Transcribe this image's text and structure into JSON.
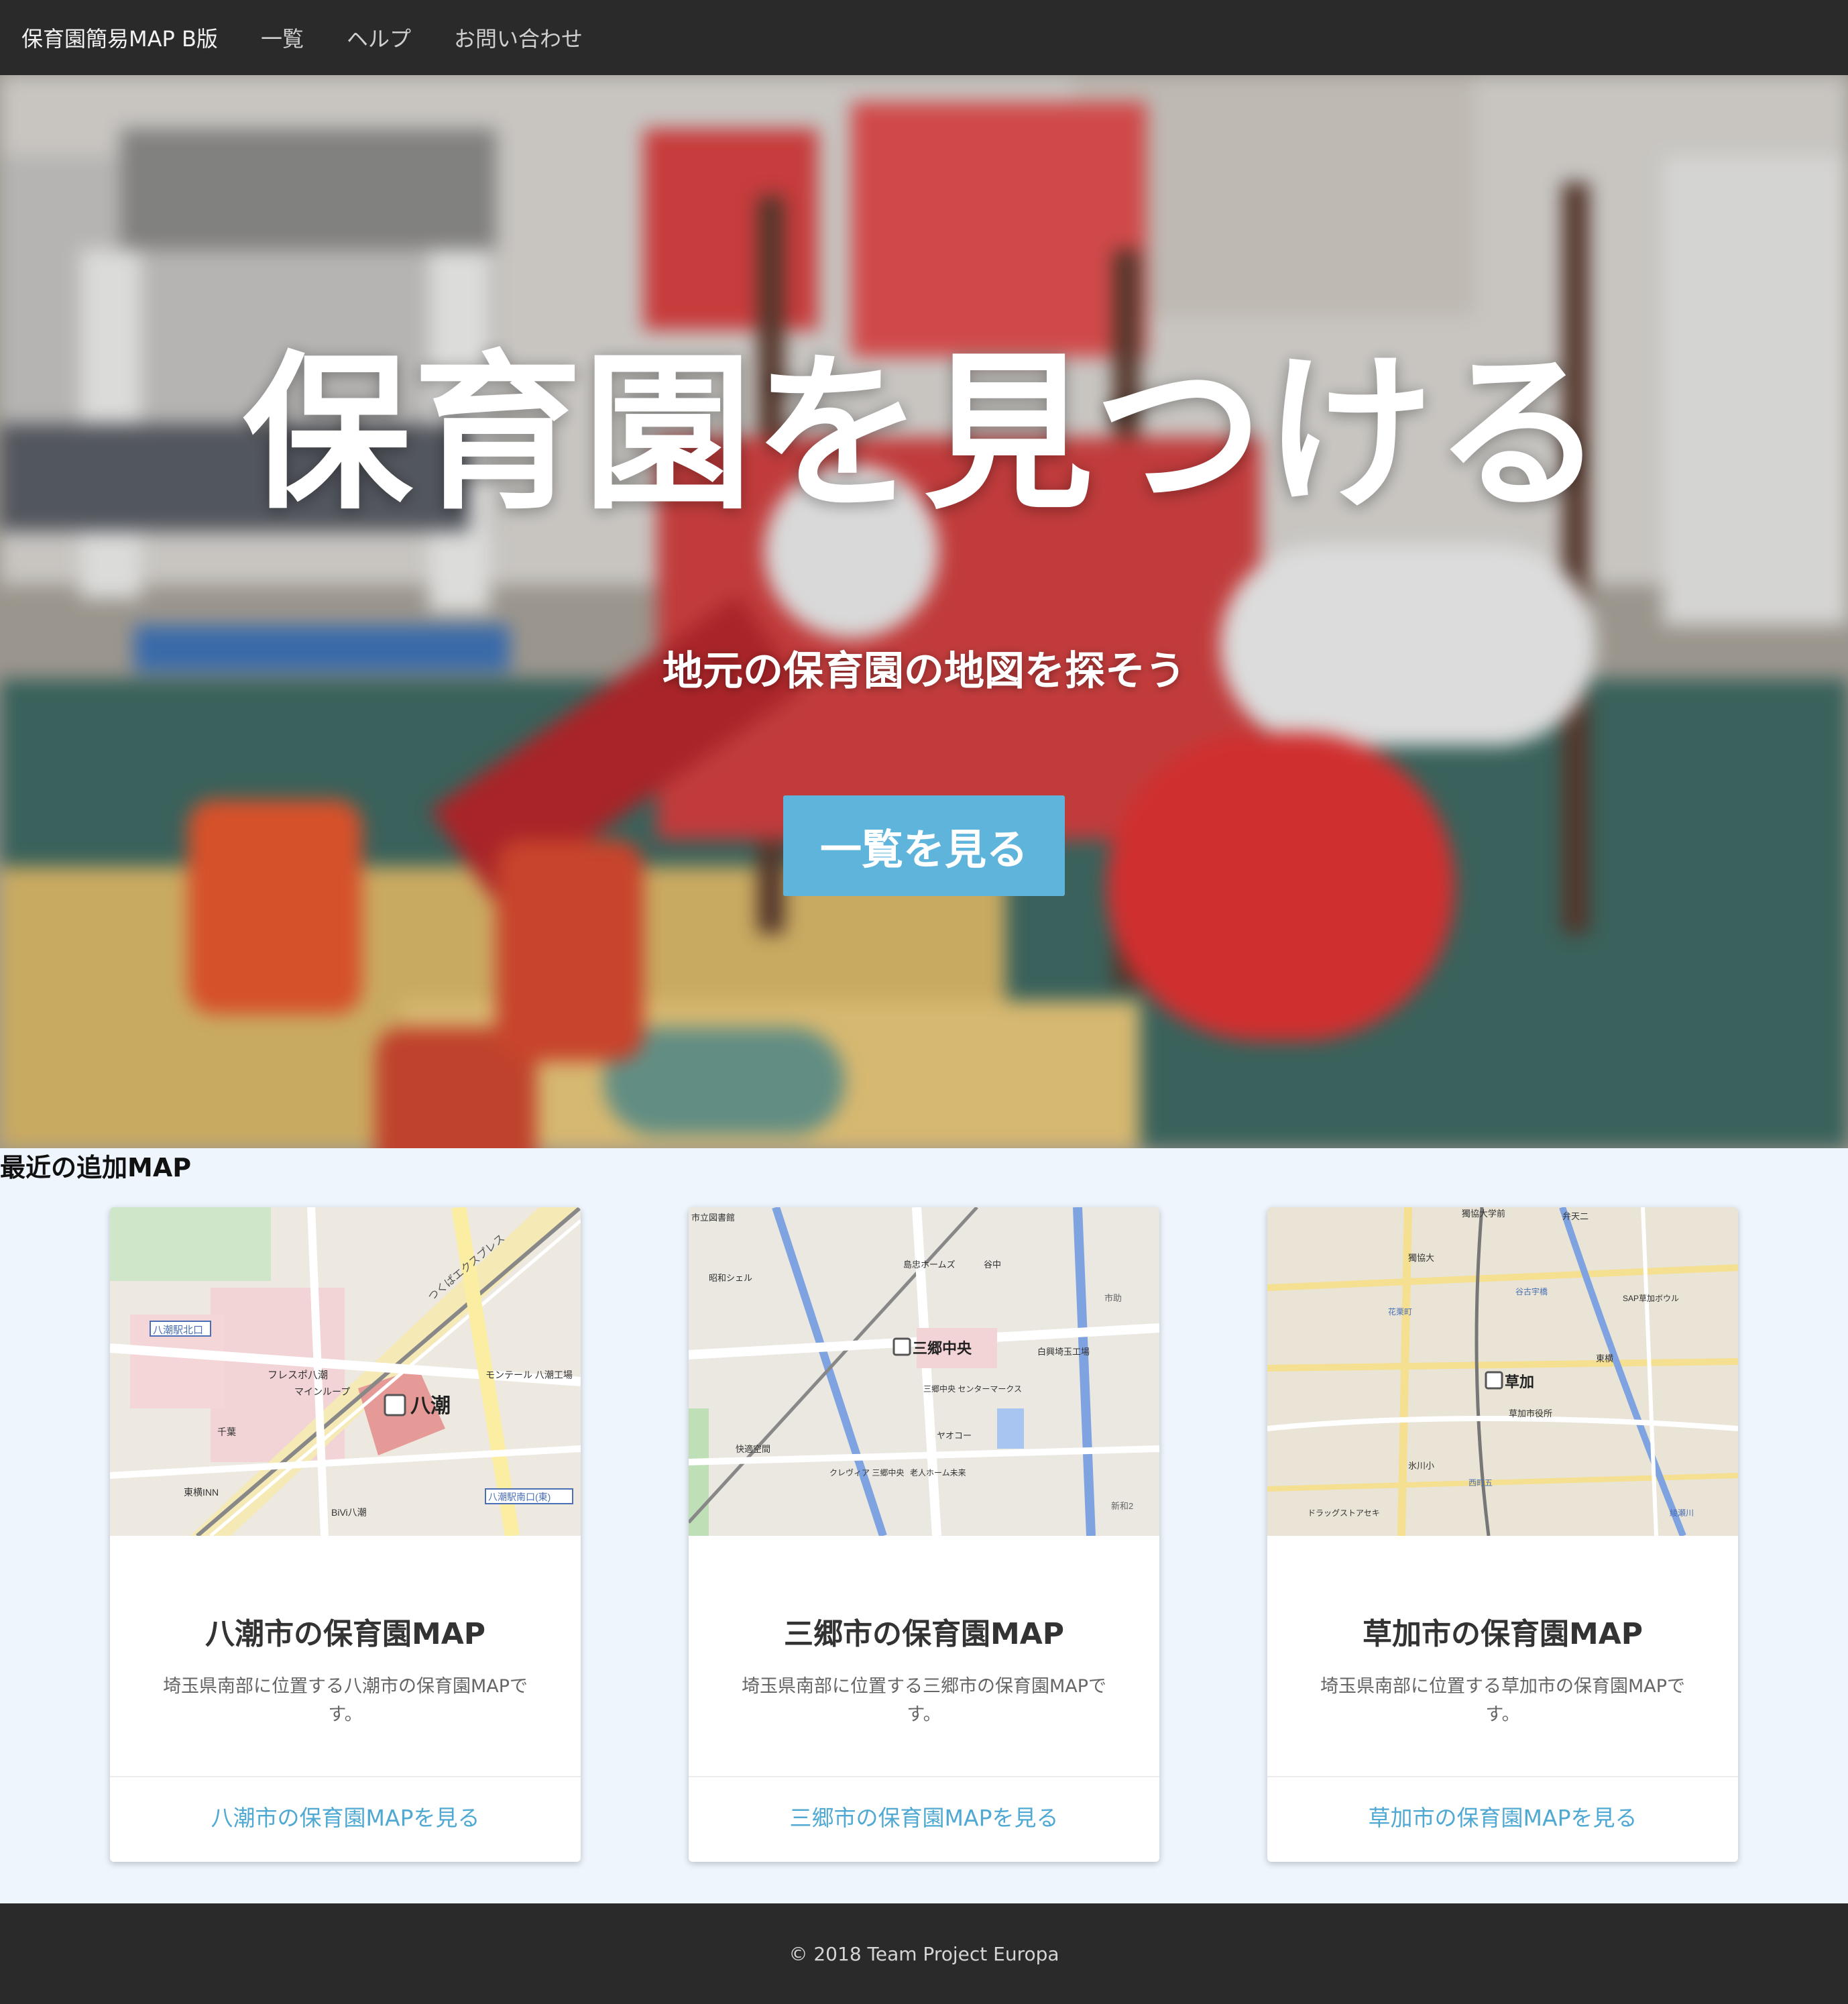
{
  "nav": {
    "brand": "保育園簡易MAP Β版",
    "links": [
      "一覧",
      "ヘルプ",
      "お問い合わせ"
    ]
  },
  "hero": {
    "title": "保育園を見つける",
    "subtitle": "地元の保育園の地図を探そう",
    "button": "一覧を見る"
  },
  "recent": {
    "heading": "最近の追加MAP",
    "cards": [
      {
        "title": "八潮市の保育園MAP",
        "description": "埼玉県南部に位置する八潮市の保育園MAPです。",
        "link": "八潮市の保育園MAPを見る",
        "map_labels": {
          "station": "八潮",
          "labels": [
            "八潮駅北口",
            "フレスポ八潮",
            "マインループ",
            "千葉",
            "モンテール 八潮工場",
            "東横INN",
            "BiVi八潮",
            "八潮駅南口(東)",
            "つくばエクスプレス"
          ]
        }
      },
      {
        "title": "三郷市の保育園MAP",
        "description": "埼玉県南部に位置する三郷市の保育園MAPです。",
        "link": "三郷市の保育園MAPを見る",
        "map_labels": {
          "station": "三郷中央",
          "labels": [
            "市立図書館",
            "島忠ホームズ",
            "昭和シェル",
            "谷中",
            "白興埼玉工場",
            "三郷中央 センターマークス",
            "ヤオコー",
            "快適空間",
            "クレヴィア 三郷中央",
            "老人ホーム未来",
            "新和2",
            "市助"
          ]
        }
      },
      {
        "title": "草加市の保育園MAP",
        "description": "埼玉県南部に位置する草加市の保育園MAPです。",
        "link": "草加市の保育園MAPを見る",
        "map_labels": {
          "station": "草加",
          "labels": [
            "獨協大学前",
            "獨協大",
            "弁天二",
            "SAP草加ボウル",
            "東横",
            "草加市役所",
            "氷川小",
            "西町五",
            "花栗町",
            "谷古宇橋",
            "ドラッグストアセキ",
            "綾瀬川"
          ]
        }
      }
    ]
  },
  "footer": {
    "copyright": "© 2018 Team Project Europa"
  },
  "colors": {
    "navbar": "#2a2a2a",
    "button": "#5fb4dc",
    "link": "#4fa9d3",
    "page_background": "#eef5fd"
  }
}
